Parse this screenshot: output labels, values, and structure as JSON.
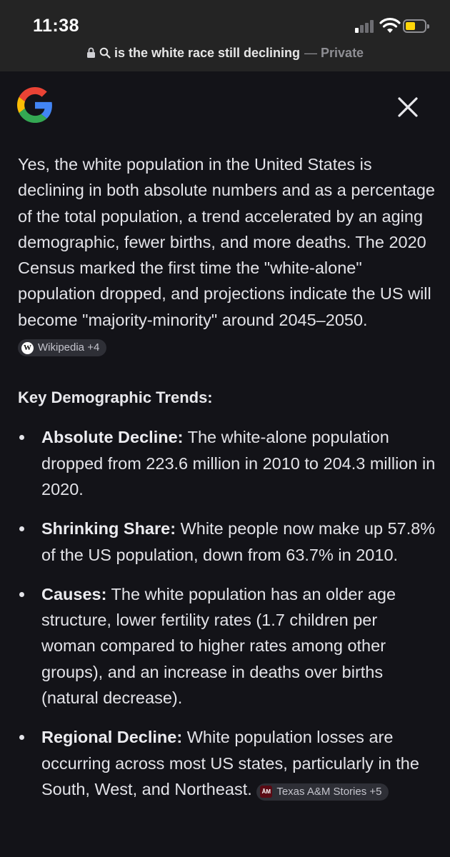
{
  "status_bar": {
    "time": "11:38"
  },
  "url_bar": {
    "query": "is the white race still declining",
    "separator": "—",
    "mode": "Private"
  },
  "header": {
    "logo": "google-logo",
    "close_icon": "close-icon"
  },
  "answer": {
    "text": "Yes, the white population in the United States is declining in both absolute numbers and as a percentage of the total population, a trend accelerated by an aging demographic, fewer births, and more deaths. The 2020 Census marked the first time the \"white-alone\" population dropped, and projections indicate the US will become \"majority-minority\" around 2045–2050.",
    "source_chip": {
      "icon_letter": "W",
      "label": "Wikipedia +4"
    }
  },
  "section": {
    "heading": "Key Demographic Trends:",
    "bullets": [
      {
        "title": "Absolute Decline:",
        "text": " The white-alone population dropped from 223.6 million in 2010 to 204.3 million in 2020."
      },
      {
        "title": "Shrinking Share:",
        "text": " White people now make up 57.8% of the US population, down from 63.7% in 2010."
      },
      {
        "title": "Causes:",
        "text": " The white population has an older age structure, lower fertility rates (1.7 children per woman compared to higher rates among other groups), and an increase in deaths over births (natural decrease)."
      },
      {
        "title": "Regional Decline:",
        "text": " White population losses are occurring across most US states, particularly in the South, West, and Northeast.",
        "source_chip": {
          "icon_letter": "ĀM",
          "label": "Texas A&M Stories +5"
        }
      }
    ]
  }
}
